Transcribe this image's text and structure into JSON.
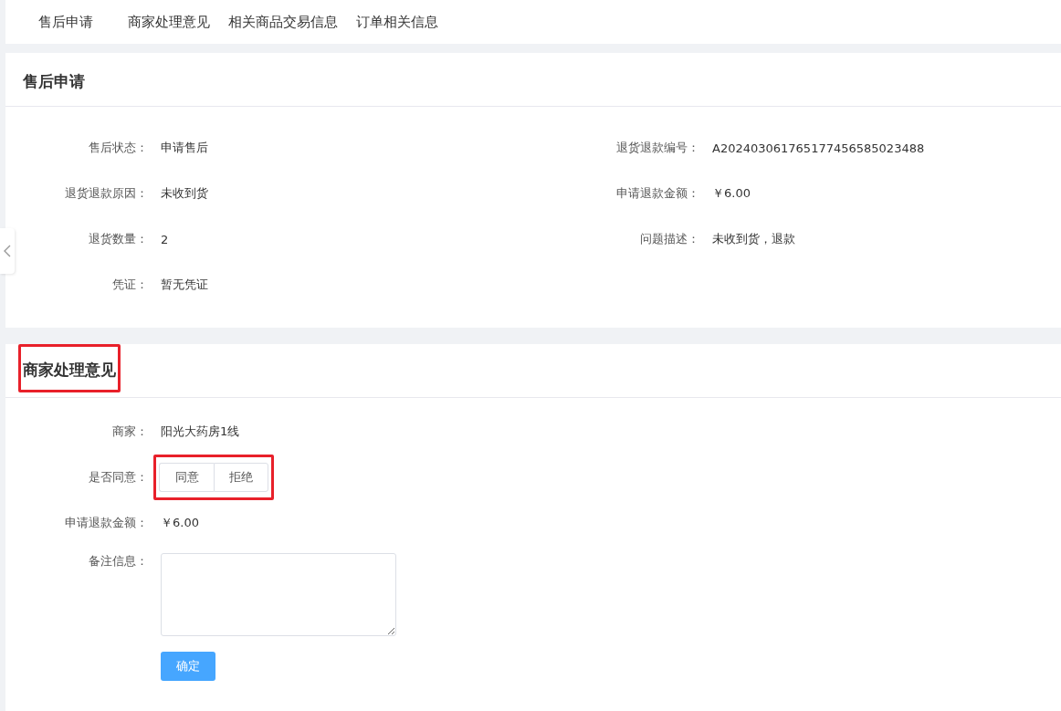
{
  "tabs": [
    {
      "label": "售后申请"
    },
    {
      "label": "商家处理意见"
    },
    {
      "label": "相关商品交易信息"
    },
    {
      "label": "订单相关信息"
    }
  ],
  "application": {
    "title": "售后申请",
    "highlighted": false,
    "left_fields": [
      {
        "label": "售后状态：",
        "value": "申请售后"
      },
      {
        "label": "退货退款原因：",
        "value": "未收到货"
      },
      {
        "label": "退货数量：",
        "value": "2"
      },
      {
        "label": "凭证：",
        "value": "暂无凭证"
      }
    ],
    "right_fields": [
      {
        "label": "退货退款编号：",
        "value": "A202403061765177456585023488"
      },
      {
        "label": "申请退款金额：",
        "value": "￥6.00"
      },
      {
        "label": "问题描述：",
        "value": "未收到货，退款"
      }
    ]
  },
  "opinion": {
    "title": "商家处理意见",
    "highlighted": true,
    "merchant": {
      "label": "商家：",
      "value": "阳光大药房1线"
    },
    "agree": {
      "label": "是否同意：",
      "highlighted": true,
      "options": [
        {
          "label": "同意",
          "selected": false
        },
        {
          "label": "拒绝",
          "selected": false
        }
      ]
    },
    "amount": {
      "label": "申请退款金额：",
      "value": "￥6.00"
    },
    "remark": {
      "label": "备注信息："
    },
    "submit": "确定"
  }
}
